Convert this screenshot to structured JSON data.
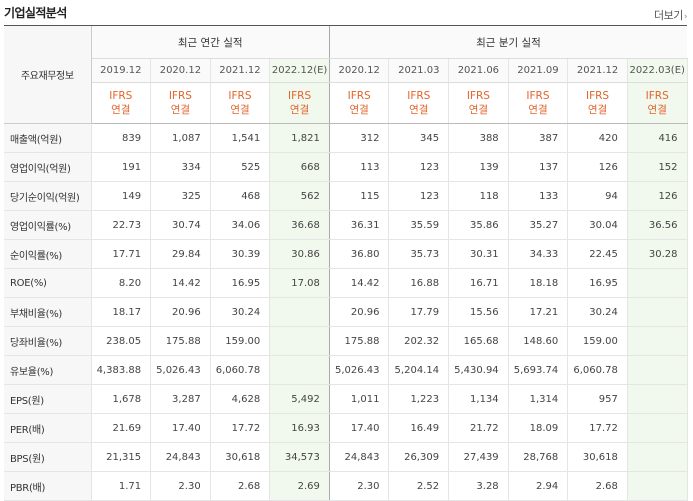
{
  "header": {
    "title": "기업실적분석",
    "more": "더보기"
  },
  "table": {
    "row_header": "주요재무정보",
    "groups": [
      "최근 연간 실적",
      "최근 분기 실적"
    ],
    "periods": [
      "2019.12",
      "2020.12",
      "2021.12",
      "2022.12(E)",
      "2020.12",
      "2021.03",
      "2021.06",
      "2021.09",
      "2021.12",
      "2022.03(E)"
    ],
    "basis_top": "IFRS",
    "basis_bottom": "연결",
    "rows": [
      {
        "label": "매출액(억원)",
        "values": [
          "839",
          "1,087",
          "1,541",
          "1,821",
          "312",
          "345",
          "388",
          "387",
          "420",
          "416"
        ]
      },
      {
        "label": "영업이익(억원)",
        "values": [
          "191",
          "334",
          "525",
          "668",
          "113",
          "123",
          "139",
          "137",
          "126",
          "152"
        ]
      },
      {
        "label": "당기순이익(억원)",
        "values": [
          "149",
          "325",
          "468",
          "562",
          "115",
          "123",
          "118",
          "133",
          "94",
          "126"
        ]
      },
      {
        "label": "영업이익률(%)",
        "values": [
          "22.73",
          "30.74",
          "34.06",
          "36.68",
          "36.31",
          "35.59",
          "35.86",
          "35.27",
          "30.04",
          "36.56"
        ]
      },
      {
        "label": "순이익률(%)",
        "values": [
          "17.71",
          "29.84",
          "30.39",
          "30.86",
          "36.80",
          "35.73",
          "30.31",
          "34.33",
          "22.45",
          "30.28"
        ]
      },
      {
        "label": "ROE(%)",
        "values": [
          "8.20",
          "14.42",
          "16.95",
          "17.08",
          "14.42",
          "16.88",
          "16.71",
          "18.18",
          "16.95",
          ""
        ]
      },
      {
        "label": "부채비율(%)",
        "values": [
          "18.17",
          "20.96",
          "30.24",
          "",
          "20.96",
          "17.79",
          "15.56",
          "17.21",
          "30.24",
          ""
        ]
      },
      {
        "label": "당좌비율(%)",
        "values": [
          "238.05",
          "175.88",
          "159.00",
          "",
          "175.88",
          "202.32",
          "165.68",
          "148.60",
          "159.00",
          ""
        ]
      },
      {
        "label": "유보율(%)",
        "values": [
          "4,383.88",
          "5,026.43",
          "6,060.78",
          "",
          "5,026.43",
          "5,204.14",
          "5,430.94",
          "5,693.74",
          "6,060.78",
          ""
        ]
      },
      {
        "label": "EPS(원)",
        "values": [
          "1,678",
          "3,287",
          "4,628",
          "5,492",
          "1,011",
          "1,223",
          "1,134",
          "1,314",
          "957",
          ""
        ]
      },
      {
        "label": "PER(배)",
        "values": [
          "21.69",
          "17.40",
          "17.72",
          "16.93",
          "17.40",
          "16.49",
          "21.72",
          "18.09",
          "17.72",
          ""
        ]
      },
      {
        "label": "BPS(원)",
        "values": [
          "21,315",
          "24,843",
          "30,618",
          "34,573",
          "24,843",
          "26,309",
          "27,439",
          "28,768",
          "30,618",
          ""
        ]
      },
      {
        "label": "PBR(배)",
        "values": [
          "1.71",
          "2.30",
          "2.68",
          "2.69",
          "2.30",
          "2.52",
          "3.28",
          "2.94",
          "2.68",
          ""
        ]
      }
    ]
  }
}
